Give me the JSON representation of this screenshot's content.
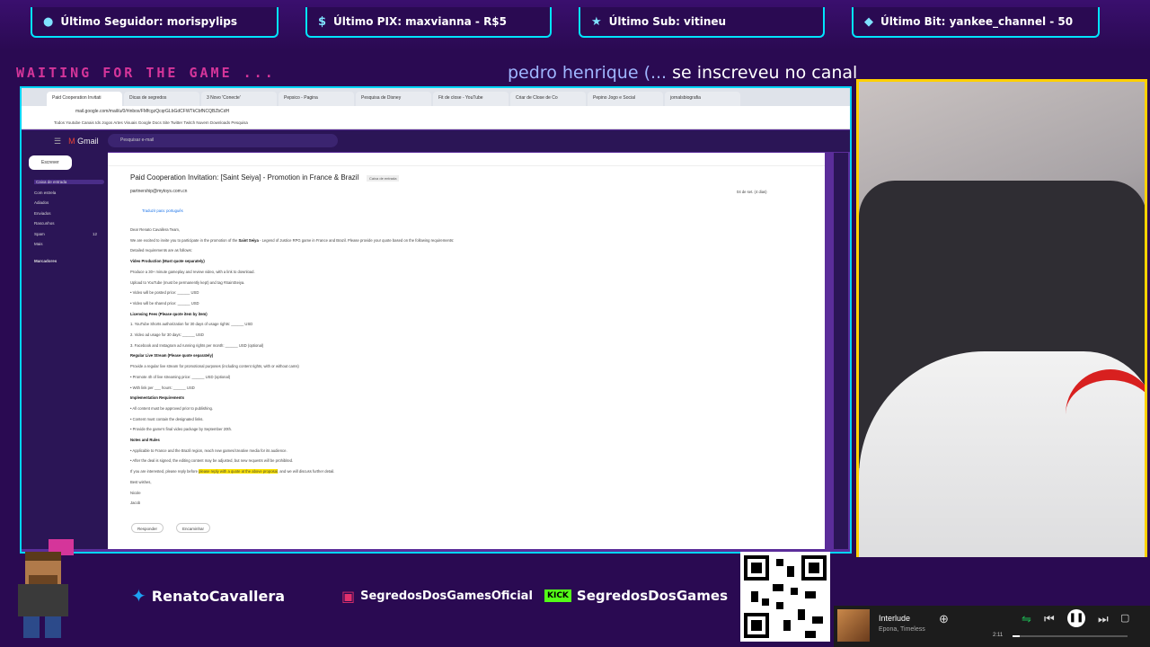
{
  "alerts": [
    {
      "icon": "person-icon",
      "text": "Último Seguidor: morispylips"
    },
    {
      "icon": "dollar-icon",
      "text": "Último PIX: maxvianna - R$5"
    },
    {
      "icon": "star-icon",
      "text": "Último Sub: vitineu"
    },
    {
      "icon": "diamond-icon",
      "text": "Último Bit: yankee_channel - 50"
    }
  ],
  "waiting_text": "WAITING FOR THE GAME ...",
  "ticker": {
    "name": "pedro henrique (...",
    "rest": " se inscreveu no canal"
  },
  "browser": {
    "tabs": [
      "Paid Cooperation Invitati",
      "Dicas de segredos",
      "3 Novo 'Conecte'",
      "Pepsico - Pagina",
      "Pesquisa de Disney",
      "Fit de close - YouTube",
      "Criar de Close de Co",
      "Pepino Jogo e Social",
      "jornalsbiografia"
    ],
    "url": "mail.google.com/mail/u/0/#inbox/FMfcgzQcqrGLbGdCFWTkCbfNCQBZbCdH",
    "bookmarks": "Todos  Youtube  Canais  Ids  Jogos  Artes  Visuais  Google  Docs  Site  Twitter  Twitch  Nuvem  Downloads  Pesquisa"
  },
  "gmail": {
    "logo": "Gmail",
    "search_placeholder": "Pesquisar e-mail",
    "compose": "Escrever",
    "nav": [
      {
        "label": "Caixa de entrada",
        "count": "",
        "selected": true
      },
      {
        "label": "Com estrela",
        "count": "",
        "selected": false
      },
      {
        "label": "Adiados",
        "count": "",
        "selected": false
      },
      {
        "label": "Enviados",
        "count": "",
        "selected": false
      },
      {
        "label": "Rascunhos",
        "count": "",
        "selected": false
      },
      {
        "label": "Spam",
        "count": "12",
        "selected": false
      },
      {
        "label": "Mais",
        "count": "",
        "selected": false
      }
    ],
    "labels_heading": "Marcadores",
    "subject": "Paid Cooperation Invitation: [Saint Seiya] - Promotion in France & Brazil",
    "label_chip": "Caixa de entrada",
    "sender": "partnership@mytoys.com.cn",
    "date": "04 de set. (4 dias)",
    "translate": "Traduzir para: português",
    "body": [
      {
        "text": "Dear Renato Cavallera Team,",
        "hl": "",
        "bold": ""
      },
      {
        "text": "We are excited to invite you to participate in the promotion of the ",
        "bold": "Saint Seiya",
        "after": " - Legend of Justice RPG game in France and Brazil. Please provide your quote based on the following requirements:",
        "hl": ""
      },
      {
        "text": "Detailed requirements are as follows:",
        "bold": "",
        "hl": ""
      },
      {
        "text": "",
        "bold": "Video Production (Must quote separately)",
        "hl": ""
      },
      {
        "text": "Produce a 30+ minute gameplay and review video, with a link to download.",
        "bold": "",
        "hl": ""
      },
      {
        "text": "Upload to YouTube (must be permanently kept) and tag #SaintSeiya.",
        "bold": "",
        "hl": ""
      },
      {
        "text": "• Video will be posted price: ______ USD",
        "bold": "",
        "hl": ""
      },
      {
        "text": "• Video will be shared price: ______ USD",
        "bold": "",
        "hl": ""
      },
      {
        "text": "",
        "bold": "Licensing Fees (Please quote item by item)",
        "hl": ""
      },
      {
        "text": "1. YouTube Shorts authorization for 30 days of usage rights: ______ USD",
        "bold": "",
        "hl": ""
      },
      {
        "text": "2. Video ad usage for 30 days: ______ USD",
        "bold": "",
        "hl": ""
      },
      {
        "text": "3. Facebook and Instagram ad running rights per month: ______ USD (optional)",
        "bold": "",
        "hl": ""
      },
      {
        "text": "",
        "bold": "Regular Live Stream (Please quote separately)",
        "hl": ""
      },
      {
        "text": "Provide a regular live stream for promotional purposes (including content rights, with or without cams)",
        "bold": "",
        "hl": ""
      },
      {
        "text": "• Promote 4h of live streaming price: ______ USD (optional)",
        "bold": "",
        "hl": ""
      },
      {
        "text": "• With link per ___ hours: ______ USD",
        "bold": "",
        "hl": ""
      },
      {
        "text": "",
        "bold": "Implementation Requirements",
        "hl": ""
      },
      {
        "text": "• All content must be approved prior to publishing.",
        "bold": "",
        "hl": ""
      },
      {
        "text": "• Content must contain the designated links.",
        "bold": "",
        "hl": ""
      },
      {
        "text": "• Provide the game's final video package by September 20th.",
        "bold": "",
        "hl": ""
      },
      {
        "text": "",
        "bold": "Notes and Rules",
        "hl": ""
      },
      {
        "text": "• Applicable to France and the Brazil region, reach new games/creative media for its audience.",
        "bold": "",
        "hl": ""
      },
      {
        "text": "• After the deal is signed, the editing content may be adjusted, but new requests will be prohibited.",
        "bold": "",
        "hl": ""
      },
      {
        "text": "If you are interested, please reply before ",
        "bold": "",
        "hl": "please reply with a quote at the above proposal",
        "after": ", and we will discuss further detail."
      },
      {
        "text": "Best wishes,",
        "bold": "",
        "hl": ""
      },
      {
        "text": "Nicole",
        "bold": "",
        "hl": ""
      },
      {
        "text": "Jacob",
        "bold": "",
        "hl": ""
      }
    ],
    "reply_buttons": [
      "Responder",
      "Encaminhar"
    ]
  },
  "socials": [
    {
      "icon": "twitter-icon",
      "text": "RenatoCavallera"
    },
    {
      "icon": "instagram-icon",
      "text": "SegredosDosGamesOficial"
    },
    {
      "icon": "kick-icon",
      "text": "SegredosDosGames",
      "badge": "KICK"
    }
  ],
  "qr_text": "livepix.gg/segredosdosgames",
  "music": {
    "title": "Interlude",
    "artist": "Epona, Timeless",
    "time": "2:11",
    "progress": 0.06
  },
  "colors": {
    "accent": "#00e5ff",
    "cam_border": "#ffd000",
    "bg": "#2a0a52",
    "waiting": "#d5359a"
  }
}
